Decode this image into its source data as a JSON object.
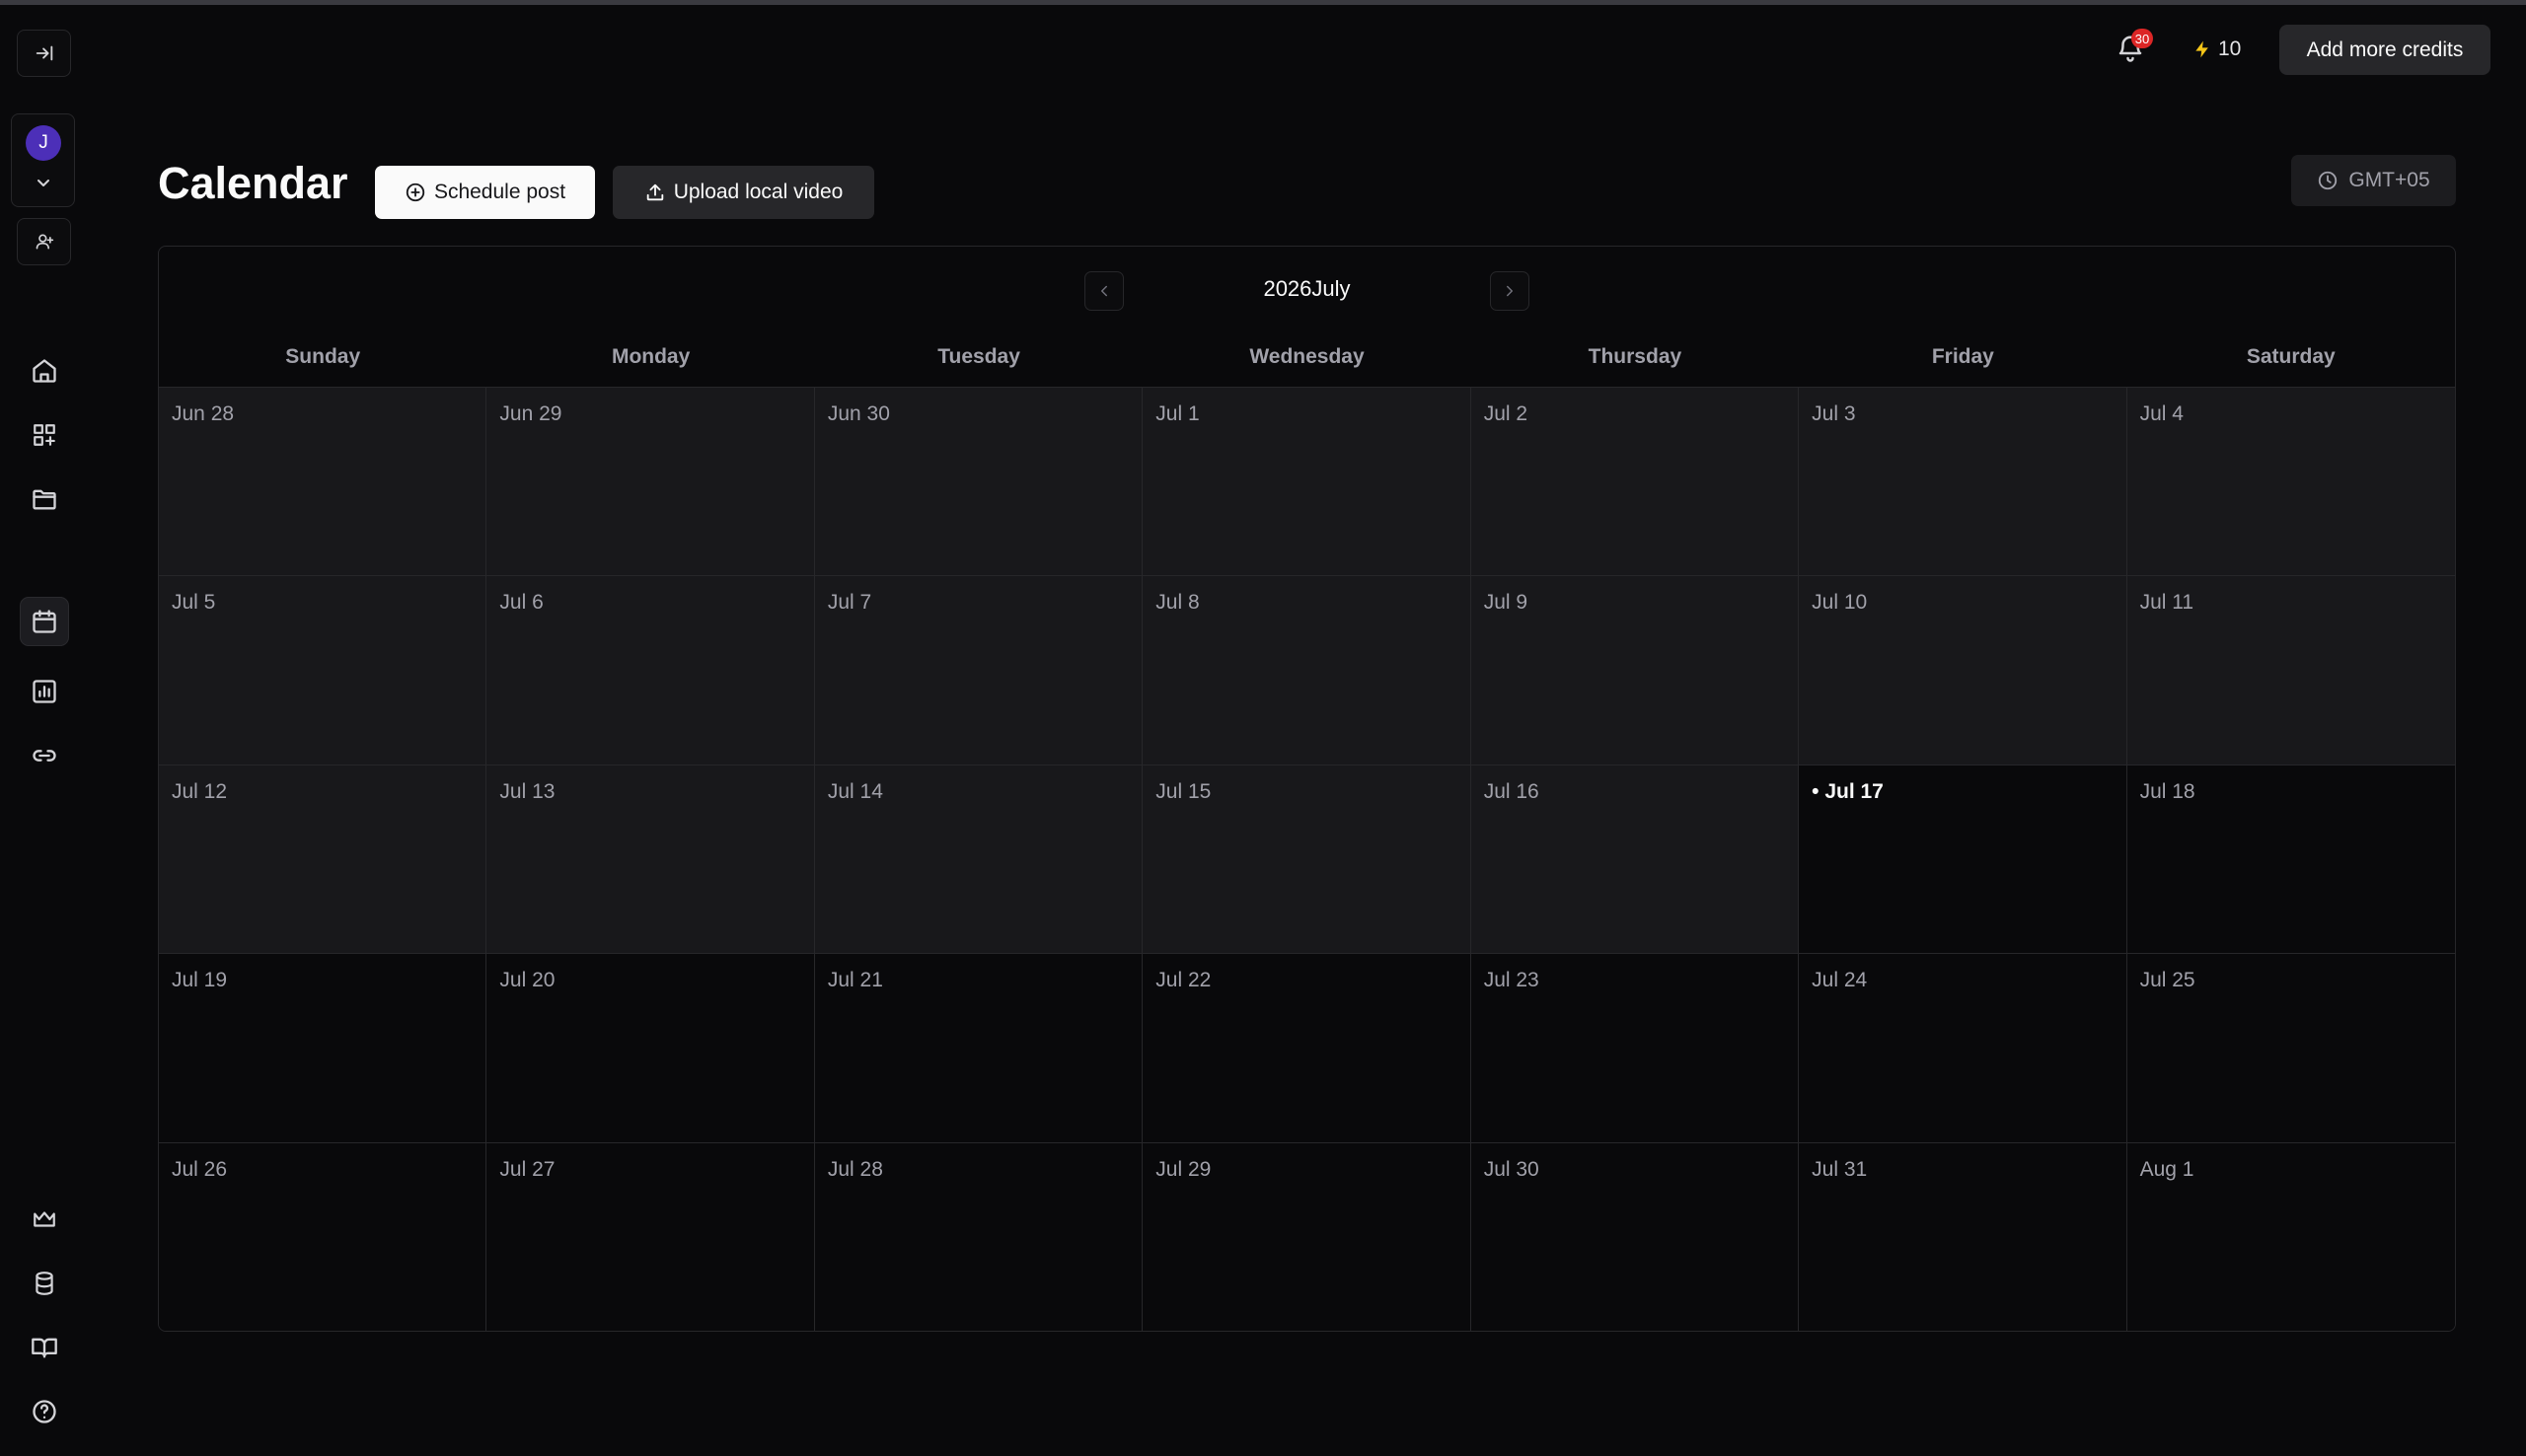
{
  "sidebar": {
    "avatar_initial": "J",
    "icons": {
      "collapse": "collapse-sidebar-icon",
      "add_user": "add-user-icon",
      "home": "home-icon",
      "apps": "apps-icon",
      "folder": "folder-icon",
      "calendar": "calendar-icon",
      "analytics": "analytics-icon",
      "link": "link-icon",
      "crown": "crown-icon",
      "database": "database-icon",
      "book": "book-icon",
      "help": "help-icon"
    }
  },
  "header": {
    "notification_count": "30",
    "credits": "10",
    "add_credits_label": "Add more credits"
  },
  "page": {
    "title": "Calendar",
    "schedule_label": "Schedule post",
    "upload_label": "Upload local video",
    "timezone": "GMT+05"
  },
  "calendar": {
    "month_label": "2026July",
    "weekdays": [
      "Sunday",
      "Monday",
      "Tuesday",
      "Wednesday",
      "Thursday",
      "Friday",
      "Saturday"
    ],
    "days": [
      "Jun 28",
      "Jun 29",
      "Jun 30",
      "Jul 1",
      "Jul 2",
      "Jul 3",
      "Jul 4",
      "Jul 5",
      "Jul 6",
      "Jul 7",
      "Jul 8",
      "Jul 9",
      "Jul 10",
      "Jul 11",
      "Jul 12",
      "Jul 13",
      "Jul 14",
      "Jul 15",
      "Jul 16",
      "• Jul 17",
      "Jul 18",
      "Jul 19",
      "Jul 20",
      "Jul 21",
      "Jul 22",
      "Jul 23",
      "Jul 24",
      "Jul 25",
      "Jul 26",
      "Jul 27",
      "Jul 28",
      "Jul 29",
      "Jul 30",
      "Jul 31",
      "Aug 1"
    ],
    "today_index": 19,
    "colors": {
      "accent_avatar": "#4c2fb8",
      "badge": "#dc2626"
    }
  }
}
